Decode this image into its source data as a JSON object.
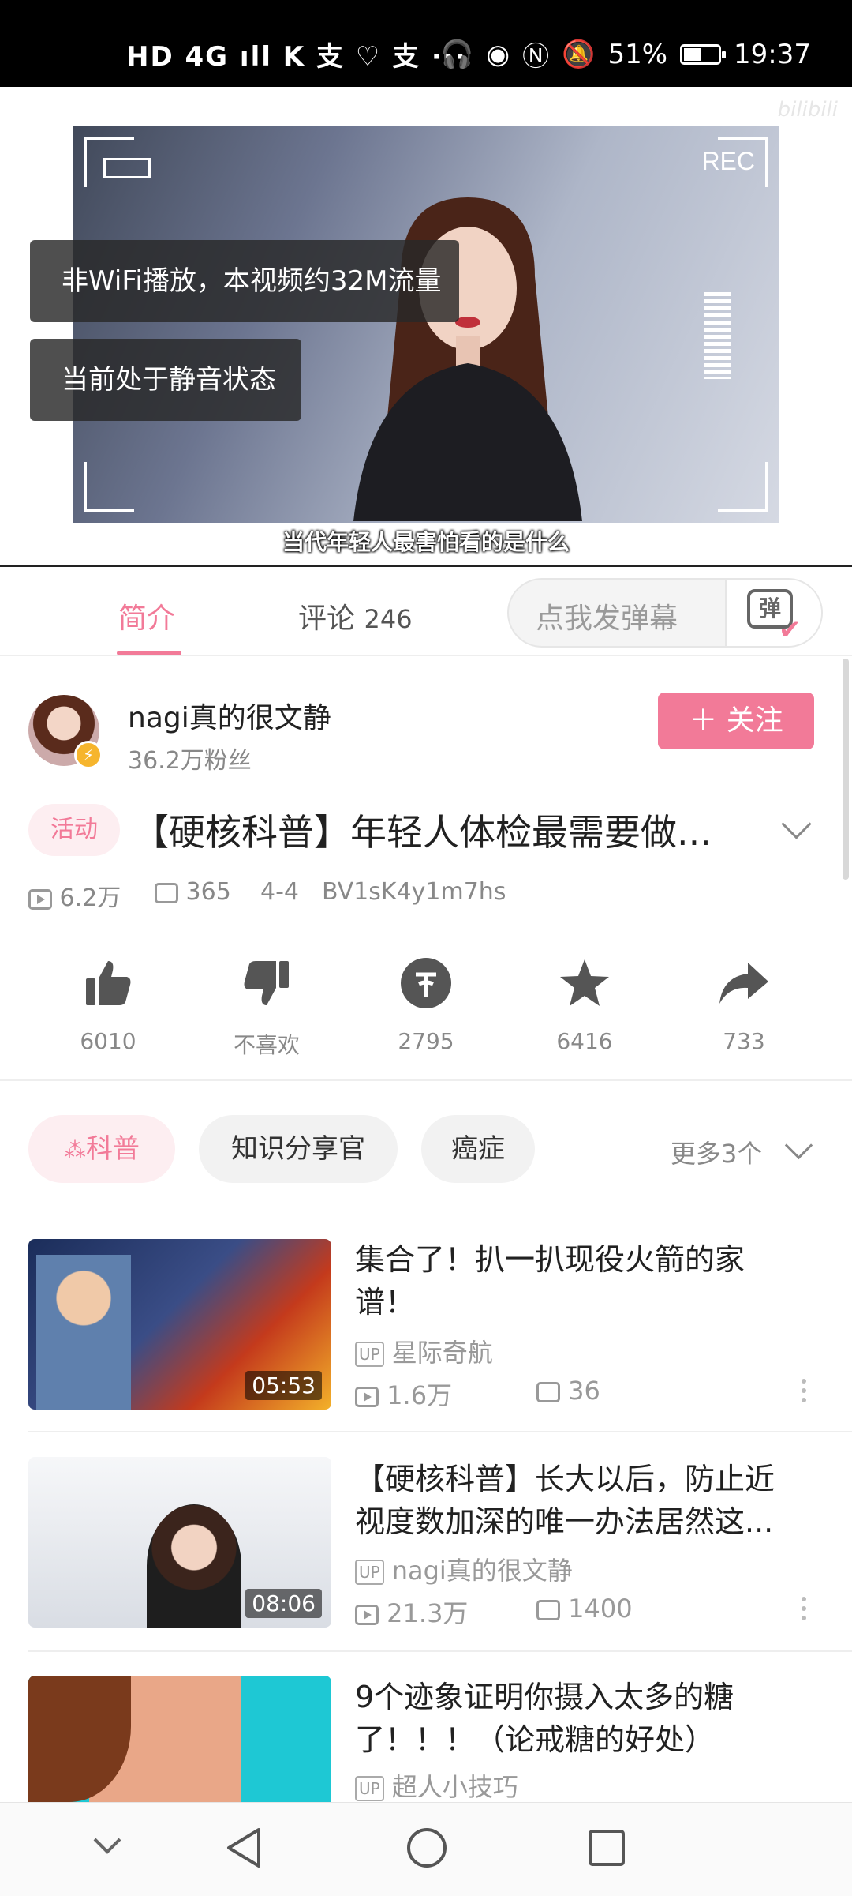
{
  "status_bar": {
    "left_icons": "HD 4G ıll K 支 ♡ 支 ···",
    "battery": "51%",
    "time": "19:37",
    "battery_level": 0.51
  },
  "player": {
    "rec_label": "REC",
    "toast_data": "非WiFi播放，本视频约32M流量",
    "toast_mute": "当前处于静音状态",
    "subtitle": "当代年轻人最害怕看的是什么",
    "watermark": "bilibili"
  },
  "tabs": {
    "intro": "简介",
    "comments": "评论",
    "comments_count": "246",
    "danmu_placeholder": "点我发弹幕",
    "danmu_icon_char": "弹"
  },
  "uploader": {
    "name": "nagi真的很文静",
    "fans": "36.2万粉丝",
    "follow_label": "关注"
  },
  "video": {
    "tag": "活动",
    "title": "【硬核科普】年轻人体检最需要做...",
    "views": "6.2万",
    "danmaku": "365",
    "date": "4-4",
    "bvid": "BV1sK4y1m7hs"
  },
  "actions": [
    {
      "name": "like",
      "label": "6010"
    },
    {
      "name": "dislike",
      "label": "不喜欢"
    },
    {
      "name": "coin",
      "label": "2795"
    },
    {
      "name": "favorite",
      "label": "6416"
    },
    {
      "name": "share",
      "label": "733"
    }
  ],
  "chips": {
    "chip1": "科普",
    "chip2": "知识分享官",
    "chip3": "癌症",
    "more": "更多3个"
  },
  "recommendations": [
    {
      "title_line1": "集合了！扒一扒现役火箭的家",
      "title_line2": "谱！",
      "up_label": "UP",
      "author": "星际奇航",
      "views": "1.6万",
      "danmaku": "36",
      "duration": "05:53"
    },
    {
      "title_line1": "【硬核科普】长大以后，防止近",
      "title_line2": "视度数加深的唯一办法居然这...",
      "up_label": "UP",
      "author": "nagi真的很文静",
      "views": "21.3万",
      "danmaku": "1400",
      "duration": "08:06"
    },
    {
      "title_line1": "9个迹象证明你摄入太多的糖",
      "title_line2": "了！！！（论戒糖的好处）",
      "up_label": "UP",
      "author": "超人小技巧"
    }
  ],
  "colors": {
    "accent": "#f27a98",
    "accent_light": "#fdeef1",
    "text": "#212121",
    "muted": "#888888"
  }
}
